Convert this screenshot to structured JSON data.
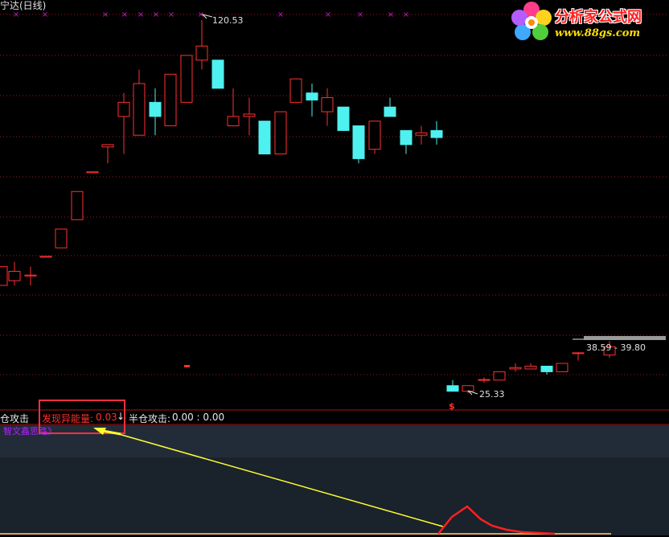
{
  "header": {
    "stock_title": "宁达(日线)"
  },
  "price_labels": {
    "high": "120.53",
    "low": "25.33",
    "range": "38.59 - 39.80",
    "signal_mark": "$"
  },
  "indicator": {
    "attack_label": "仓攻击",
    "energy_label": "发现异能量:",
    "energy_value": "0.03",
    "arrow": "↓",
    "half_label": "半仓攻击:",
    "half_value": "0.00 : 0.00",
    "caption": "智文鑫思路》"
  },
  "logo": {
    "name": "分析家公式网",
    "url": "www.88gs.com"
  },
  "colors": {
    "up": "#ff3030",
    "down": "#4ef0f0",
    "grid": "#a01818",
    "background": "#000000",
    "indicator_bg": "#1e2630",
    "highlight_box": "#ff3040",
    "arrow_line": "#ffff30",
    "energy_line": "#ff2020"
  },
  "chart_data": {
    "type": "candlestick",
    "title": "宁达(日线)",
    "ylim": [
      20,
      130
    ],
    "high_annotation": 120.53,
    "low_annotation": 25.33,
    "candles": [
      {
        "o": 64,
        "c": 68,
        "h": 68,
        "l": 64
      },
      {
        "o": 65,
        "c": 67,
        "h": 69,
        "l": 64
      },
      {
        "o": 66,
        "c": 66.2,
        "h": 68,
        "l": 64
      },
      {
        "o": 70,
        "c": 70.2,
        "h": 70.2,
        "l": 70
      },
      {
        "o": 72,
        "c": 76,
        "h": 76,
        "l": 72
      },
      {
        "o": 78,
        "c": 84,
        "h": 84,
        "l": 78
      },
      {
        "o": 88,
        "c": 88.2,
        "h": 88.2,
        "l": 88
      },
      {
        "o": 93.5,
        "c": 94,
        "h": 94,
        "l": 90
      },
      {
        "o": 100,
        "c": 103,
        "h": 105,
        "l": 92
      },
      {
        "o": 96,
        "c": 107,
        "h": 110,
        "l": 96
      },
      {
        "o": 103,
        "c": 100,
        "h": 106,
        "l": 96
      },
      {
        "o": 98,
        "c": 109,
        "h": 109,
        "l": 98
      },
      {
        "o": 103,
        "c": 113,
        "h": 113,
        "l": 103
      },
      {
        "o": 112,
        "c": 115,
        "h": 120.53,
        "l": 110
      },
      {
        "o": 112,
        "c": 106,
        "h": 112,
        "l": 106
      },
      {
        "o": 98,
        "c": 100,
        "h": 106,
        "l": 98
      },
      {
        "o": 100,
        "c": 100.5,
        "h": 104,
        "l": 96
      },
      {
        "o": 99,
        "c": 92,
        "h": 99,
        "l": 92
      },
      {
        "o": 92,
        "c": 101,
        "h": 101,
        "l": 92
      },
      {
        "o": 103,
        "c": 108,
        "h": 108,
        "l": 103
      },
      {
        "o": 105,
        "c": 103.5,
        "h": 107,
        "l": 100
      },
      {
        "o": 101,
        "c": 104,
        "h": 106,
        "l": 98
      },
      {
        "o": 102,
        "c": 97,
        "h": 102,
        "l": 97
      },
      {
        "o": 98,
        "c": 91,
        "h": 98,
        "l": 90
      },
      {
        "o": 93,
        "c": 99,
        "h": 99,
        "l": 92
      },
      {
        "o": 102,
        "c": 100,
        "h": 104,
        "l": 100
      },
      {
        "o": 97,
        "c": 94,
        "h": 97,
        "l": 92
      },
      {
        "o": 96,
        "c": 96.5,
        "h": 98,
        "l": 94
      },
      {
        "o": 97,
        "c": 95.5,
        "h": 99,
        "l": 94
      },
      {
        "o": 28,
        "c": 26,
        "h": 30,
        "l": 26
      },
      {
        "o": 26,
        "c": 28,
        "h": 28,
        "l": 25.33
      },
      {
        "o": 30,
        "c": 30.2,
        "h": 31,
        "l": 29
      },
      {
        "o": 30,
        "c": 33,
        "h": 33,
        "l": 30
      },
      {
        "o": 34,
        "c": 34.5,
        "h": 36,
        "l": 33
      },
      {
        "o": 34,
        "c": 35,
        "h": 36,
        "l": 34
      },
      {
        "o": 35,
        "c": 33,
        "h": 35,
        "l": 32
      },
      {
        "o": 33,
        "c": 36,
        "h": 36,
        "l": 33
      },
      {
        "o": 39.5,
        "c": 39.8,
        "h": 40,
        "l": 37
      },
      {
        "o": 39,
        "c": 42,
        "h": 44,
        "l": 38
      }
    ],
    "indicator": {
      "name": "发现异能量",
      "value": 0.03
    }
  }
}
